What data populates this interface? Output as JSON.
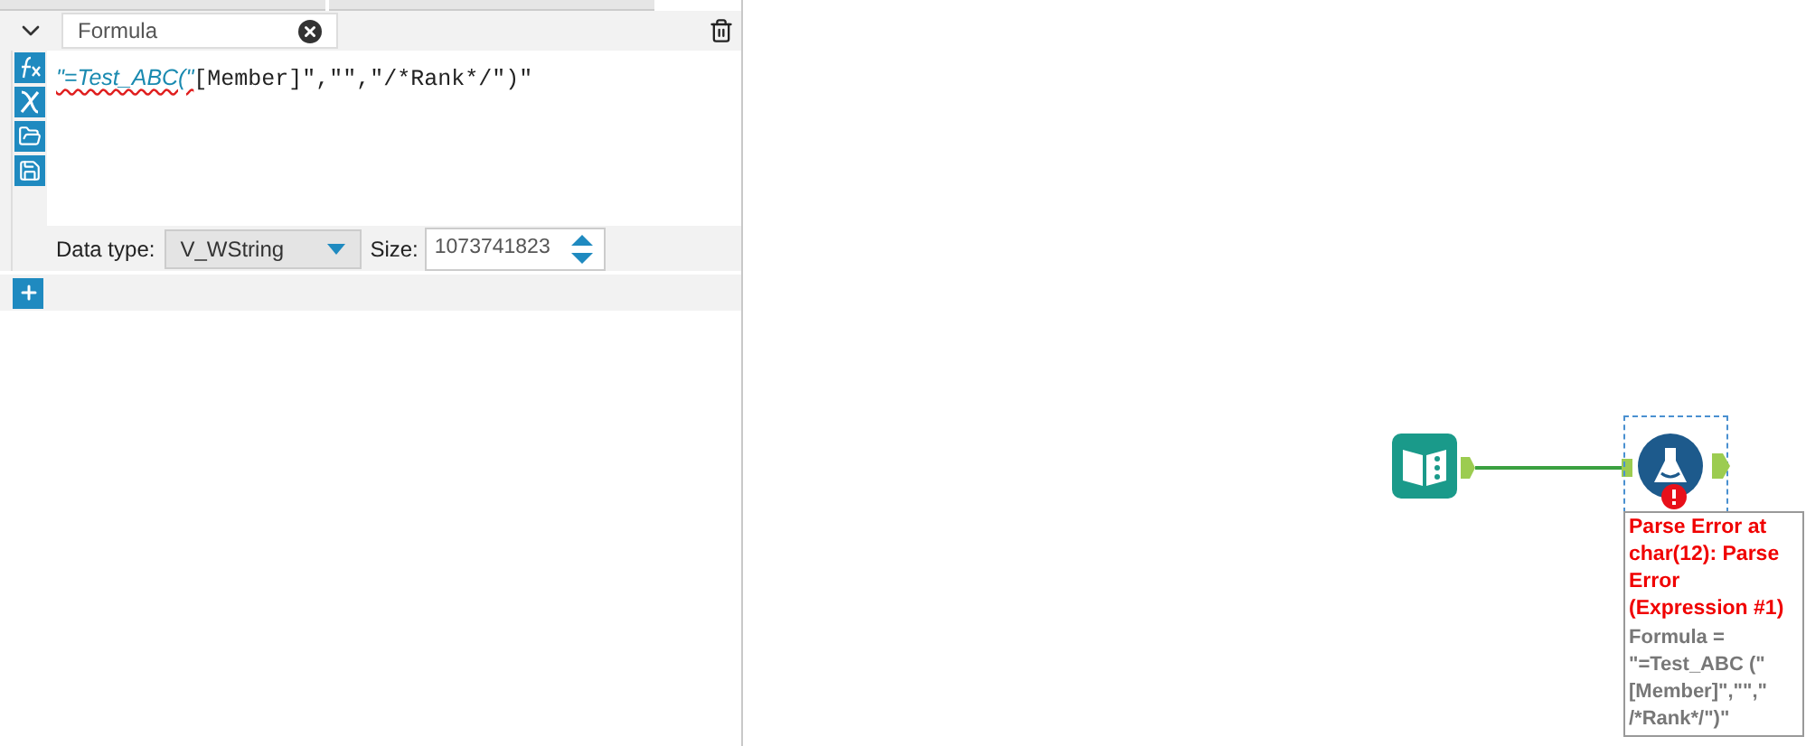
{
  "formula_panel": {
    "output_column": {
      "value": "Formula"
    },
    "expression": [
      {
        "kind": "string",
        "text": "\"=Test_ABC(\""
      },
      {
        "kind": "plain",
        "text": "[Member]\",\"\",\"/*Rank*/\")\""
      }
    ],
    "data_type": {
      "label": "Data type:",
      "value": "V_WString"
    },
    "size": {
      "label": "Size:",
      "value": "1073741823"
    }
  },
  "canvas": {
    "tool_error": {
      "error": "Parse Error at char(12): Parse Error (Expression #1)",
      "detail": "Formula = \"=Test_ABC (\"[Member]\",\"\",\" /*Rank*/\")\""
    }
  }
}
